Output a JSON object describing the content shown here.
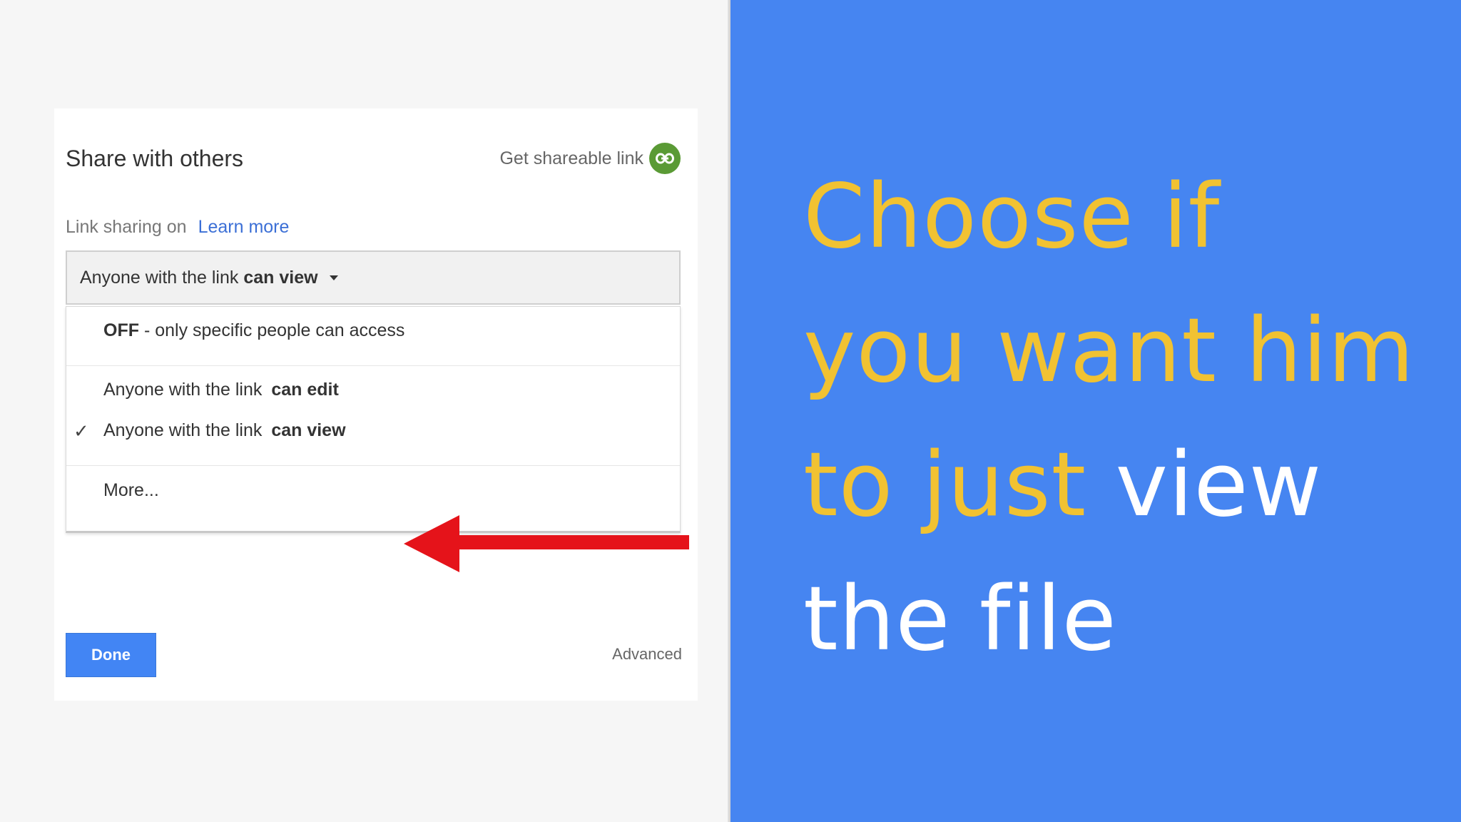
{
  "dialog": {
    "title": "Share with others",
    "get_link_label": "Get shareable link",
    "link_sharing_label": "Link sharing on",
    "learn_more": "Learn more",
    "select": {
      "prefix": "Anyone with the link",
      "bold": "can view"
    },
    "options": [
      {
        "prefix": "OFF",
        "suffix": "- only specific people can access"
      },
      {
        "prefix": "Anyone with the link",
        "bold": "can edit"
      },
      {
        "prefix": "Anyone with the link",
        "bold": "can view",
        "checkmark": "✓"
      },
      {
        "prefix": "More..."
      }
    ],
    "done_label": "Done",
    "advanced_label": "Advanced"
  },
  "caption": {
    "line1": "Choose if",
    "line2": "you want him",
    "line3_yellow": "to just",
    "line3_white": "view",
    "line4": "the file"
  },
  "colors": {
    "right_background": "#4685f1",
    "caption_yellow": "#f1c232",
    "caption_white": "#ffffff",
    "done_button": "#4285f4",
    "link_icon": "#5a9a35",
    "arrow": "#e5131a"
  },
  "icons": {
    "link": "link-icon",
    "arrow": "red-arrow-left"
  }
}
